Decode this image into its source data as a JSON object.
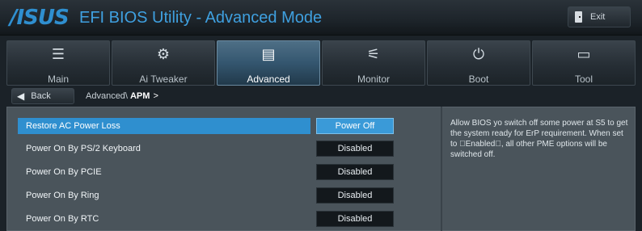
{
  "header": {
    "logo_text": "/ISUS",
    "title": "EFI BIOS Utility - Advanced Mode",
    "exit_label": "Exit"
  },
  "tabs": [
    {
      "label": "Main",
      "icon": "list-icon"
    },
    {
      "label": "Ai  Tweaker",
      "icon": "tweaker-icon"
    },
    {
      "label": "Advanced",
      "icon": "advanced-icon",
      "active": true
    },
    {
      "label": "Monitor",
      "icon": "monitor-icon"
    },
    {
      "label": "Boot",
      "icon": "power-icon"
    },
    {
      "label": "Tool",
      "icon": "tool-icon"
    }
  ],
  "breadcrumb": {
    "back_label": "Back",
    "path": "Advanced\\",
    "current": "APM",
    "arrow": ">"
  },
  "settings": [
    {
      "label": "Restore AC Power Loss",
      "value": "Power Off",
      "selected": true
    },
    {
      "label": "Power On By PS/2 Keyboard",
      "value": "Disabled"
    },
    {
      "label": "Power On By PCIE",
      "value": "Disabled"
    },
    {
      "label": "Power On By Ring",
      "value": "Disabled"
    },
    {
      "label": "Power On By RTC",
      "value": "Disabled"
    }
  ],
  "help_text": "Allow BIOS yo switch off some power at S5 to get the system ready for ErP requirement. When set to \u0000Enabled\u0000, all other PME options will be switched off.",
  "colors": {
    "accent": "#2f8fcf",
    "title_blue": "#3fa0e0",
    "panel_bg": "#4a545b"
  }
}
